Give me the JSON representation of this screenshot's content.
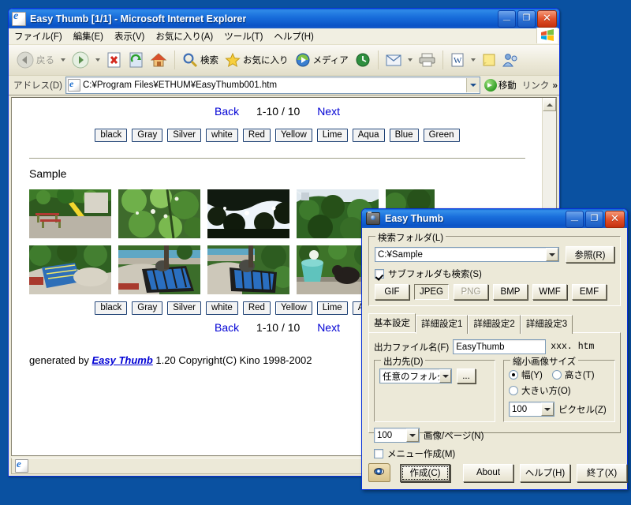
{
  "desktop": {
    "background_color": "#0a51a1"
  },
  "browser": {
    "title": "Easy Thumb [1/1] - Microsoft Internet Explorer",
    "icon": "ie-document-icon",
    "window_buttons": {
      "minimize": "_",
      "maximize": "❐",
      "close": "✕"
    },
    "menus": [
      {
        "label": "ファイル(F)"
      },
      {
        "label": "編集(E)"
      },
      {
        "label": "表示(V)"
      },
      {
        "label": "お気に入り(A)"
      },
      {
        "label": "ツール(T)"
      },
      {
        "label": "ヘルプ(H)"
      }
    ],
    "toolbar": [
      {
        "name": "back",
        "label": "戻る",
        "icon": "back-arrow-icon",
        "has_caret": true,
        "disabled": true
      },
      {
        "name": "forward",
        "label": "",
        "icon": "forward-arrow-icon",
        "has_caret": true,
        "disabled": true
      },
      {
        "name": "stop",
        "label": "",
        "icon": "stop-icon",
        "has_caret": false,
        "disabled": false
      },
      {
        "name": "refresh",
        "label": "",
        "icon": "refresh-icon",
        "has_caret": false,
        "disabled": false
      },
      {
        "name": "home",
        "label": "",
        "icon": "home-icon",
        "has_caret": false,
        "disabled": false
      },
      {
        "name": "search",
        "label": "検索",
        "icon": "search-icon",
        "has_caret": false,
        "disabled": false
      },
      {
        "name": "favorites",
        "label": "お気に入り",
        "icon": "star-icon",
        "has_caret": false,
        "disabled": false
      },
      {
        "name": "media",
        "label": "メディア",
        "icon": "media-icon",
        "has_caret": false,
        "disabled": false
      },
      {
        "name": "history",
        "label": "",
        "icon": "history-icon",
        "has_caret": false,
        "disabled": false
      },
      {
        "name": "mail",
        "label": "",
        "icon": "mail-icon",
        "has_caret": true,
        "disabled": false
      },
      {
        "name": "print",
        "label": "",
        "icon": "printer-icon",
        "has_caret": false,
        "disabled": false
      },
      {
        "name": "edit",
        "label": "",
        "icon": "word-edit-icon",
        "has_caret": true,
        "disabled": false
      },
      {
        "name": "notes",
        "label": "",
        "icon": "note-icon",
        "has_caret": false,
        "disabled": false
      },
      {
        "name": "messenger",
        "label": "",
        "icon": "messenger-icon",
        "has_caret": false,
        "disabled": false
      }
    ],
    "address": {
      "label": "アドレス(D)",
      "value": "C:¥Program Files¥ETHUM¥EasyThumb001.htm",
      "go_label": "移動",
      "links_label": "リンク",
      "overflow_chevron": "»"
    },
    "status_bar": {
      "text": ""
    }
  },
  "page": {
    "nav_top": {
      "back": "Back",
      "counter": "1-10 / 10",
      "next": "Next"
    },
    "nav_bottom": {
      "back": "Back",
      "counter": "1-10 / 10",
      "next": "Next"
    },
    "color_buttons": [
      "black",
      "Gray",
      "Silver",
      "white",
      "Red",
      "Yellow",
      "Lime",
      "Aqua",
      "Blue",
      "Green"
    ],
    "heading": "Sample",
    "thumbnails": [
      {
        "alt": "playground with yellow slide and red benches"
      },
      {
        "alt": "green leaves close up with white flowers"
      },
      {
        "alt": "tree branches against bright sky"
      },
      {
        "alt": "hedge and shrubs with building behind"
      },
      {
        "alt": "bushes along a street"
      },
      {
        "alt": "blue pipe structure with cat on concrete"
      },
      {
        "alt": "blue slatted pipe with cat sitting"
      },
      {
        "alt": "blue ramp structure beside fence"
      },
      {
        "alt": "cat beside teal planter on pavement"
      },
      {
        "alt": "partially covered thumbnail"
      }
    ],
    "footer": {
      "prefix": "generated by ",
      "link": "Easy Thumb",
      "suffix": " 1.20  Copyright(C) Kino 1998-2002"
    }
  },
  "dialog": {
    "title": "Easy Thumb",
    "icon": "camera-icon",
    "window_buttons": {
      "minimize": "_",
      "maximize": "❐",
      "close": "✕"
    },
    "search_folder": {
      "group_label": "検索フォルダ(L)",
      "path_value": "C:¥Sample",
      "browse_label": "参照(R)",
      "subfolder_label": "サブフォルダも検索(S)",
      "subfolder_checked": true,
      "formats": [
        {
          "label": "GIF",
          "state": "normal"
        },
        {
          "label": "JPEG",
          "state": "pressed"
        },
        {
          "label": "PNG",
          "state": "disabled"
        },
        {
          "label": "BMP",
          "state": "normal"
        },
        {
          "label": "WMF",
          "state": "normal"
        },
        {
          "label": "EMF",
          "state": "normal"
        }
      ]
    },
    "tabs": [
      {
        "label": "基本設定",
        "active": true
      },
      {
        "label": "詳細設定1",
        "active": false
      },
      {
        "label": "詳細設定2",
        "active": false
      },
      {
        "label": "詳細設定3",
        "active": false
      }
    ],
    "basic_tab": {
      "output_file_label": "出力ファイル名(F)",
      "output_file_value": "EasyThumb",
      "output_file_suffix": "xxx. htm",
      "output_dest": {
        "group_label": "出力先(D)",
        "value": "任意のフォルダ",
        "browse_label": "..."
      },
      "images_per_page": {
        "value": "100",
        "label": "画像/ページ(N)"
      },
      "make_menu": {
        "label": "メニュー作成(M)",
        "checked": false
      },
      "thumb_size": {
        "group_label": "縮小画像サイズ",
        "options": [
          {
            "label": "幅(Y)",
            "selected": true
          },
          {
            "label": "高さ(T)",
            "selected": false
          },
          {
            "label": "大きい方(O)",
            "selected": false
          }
        ],
        "pixel_value": "100",
        "pixel_label": "ピクセル(Z)"
      }
    },
    "footer_buttons": [
      {
        "label": "作成(C)",
        "name": "create-button",
        "default": true
      },
      {
        "label": "About",
        "name": "about-button",
        "default": false
      },
      {
        "label": "ヘルプ(H)",
        "name": "help-button",
        "default": false
      },
      {
        "label": "終了(X)",
        "name": "exit-button",
        "default": false
      }
    ],
    "footer_icon": "eye-folder-icon"
  }
}
